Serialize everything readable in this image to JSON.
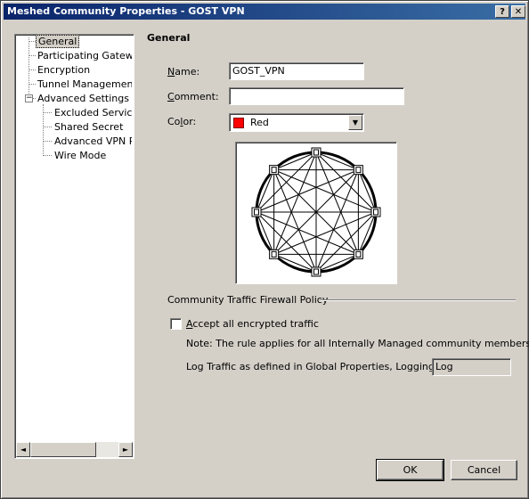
{
  "window": {
    "title": "Meshed Community Properties - GOST VPN",
    "help_label": "?",
    "close_label": "✕"
  },
  "tree": {
    "items": [
      {
        "label": "General",
        "selected": true
      },
      {
        "label": "Participating Gateways"
      },
      {
        "label": "Encryption"
      },
      {
        "label": "Tunnel Management"
      },
      {
        "label": "Advanced Settings",
        "expander": "−"
      },
      {
        "label": "Excluded Services"
      },
      {
        "label": "Shared Secret"
      },
      {
        "label": "Advanced VPN Pr"
      },
      {
        "label": "Wire Mode"
      }
    ],
    "scroll_left": "◄",
    "scroll_right": "►"
  },
  "general": {
    "section_title": "General",
    "name_label": "Name:",
    "name_value": "GOST_VPN",
    "comment_label": "Comment:",
    "comment_value": "",
    "color_label": "Color:",
    "color_value": "Red",
    "color_hex": "#ff0000",
    "dropdown_arrow": "▼"
  },
  "policy": {
    "group_label": "Community Traffic Firewall Policy",
    "accept_label": "Accept all encrypted traffic",
    "accept_checked": false,
    "note": "Note: The rule applies for all Internally Managed community members.",
    "log_label": "Log Traffic as defined in Global Properties, Logging Tab:",
    "log_value": "Log"
  },
  "buttons": {
    "ok": "OK",
    "cancel": "Cancel"
  }
}
